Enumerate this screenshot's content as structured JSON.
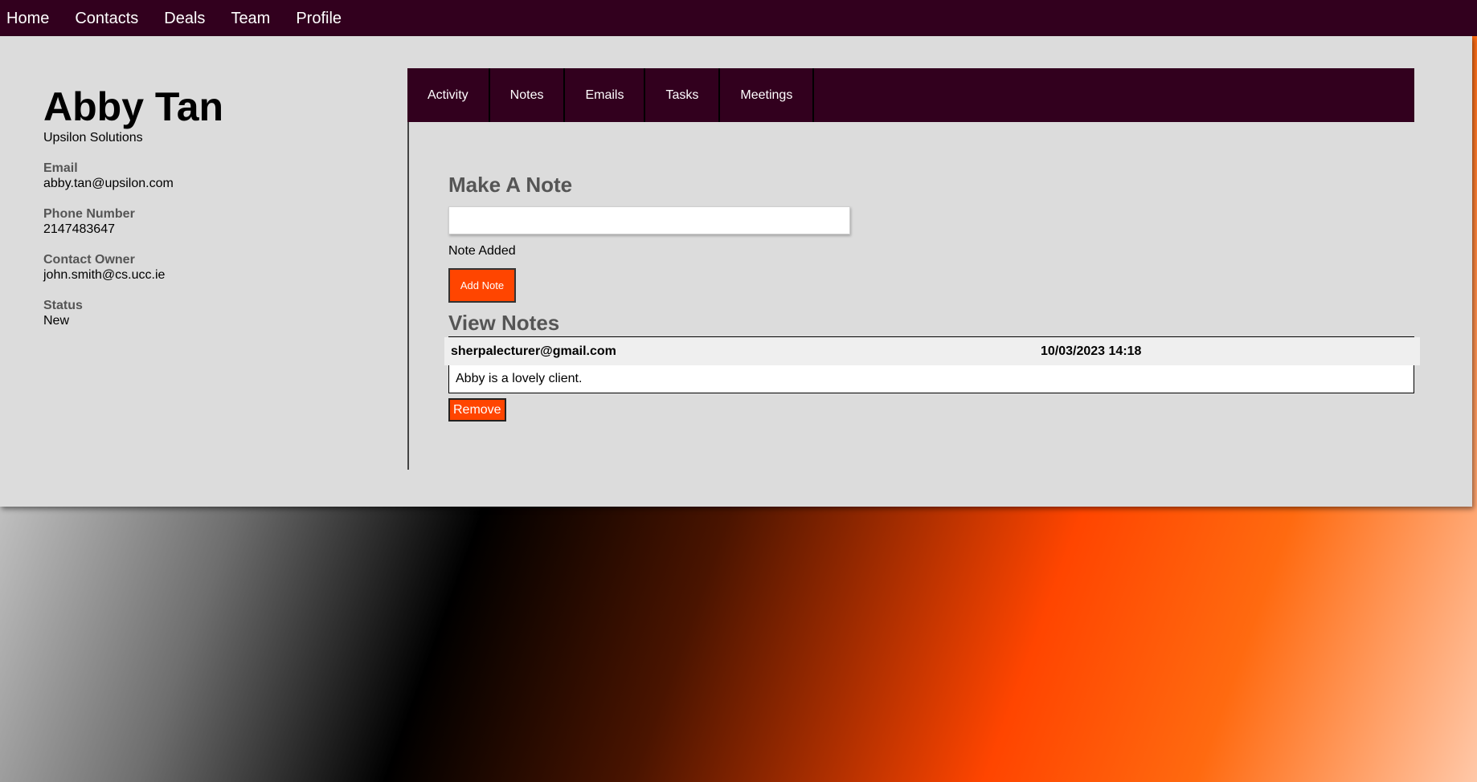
{
  "nav": {
    "items": [
      "Home",
      "Contacts",
      "Deals",
      "Team",
      "Profile"
    ]
  },
  "contact": {
    "name": "Abby Tan",
    "company": "Upsilon Solutions",
    "email_label": "Email",
    "email": "abby.tan@upsilon.com",
    "phone_label": "Phone Number",
    "phone": "2147483647",
    "owner_label": "Contact Owner",
    "owner": "john.smith@cs.ucc.ie",
    "status_label": "Status",
    "status": "New"
  },
  "tabs": [
    "Activity",
    "Notes",
    "Emails",
    "Tasks",
    "Meetings"
  ],
  "notes_panel": {
    "make_title": "Make A Note",
    "input_value": "",
    "input_placeholder": "",
    "status_message": "Note Added",
    "add_button": "Add Note",
    "view_title": "View Notes",
    "notes": [
      {
        "author": "sherpalecturer@gmail.com",
        "date": "10/03/2023 14:18",
        "body": "Abby is a lovely client.",
        "remove_label": "Remove"
      }
    ]
  },
  "colors": {
    "nav_bg": "#32001e",
    "panel_bg": "#dcdcdc",
    "accent": "#ff4500"
  }
}
